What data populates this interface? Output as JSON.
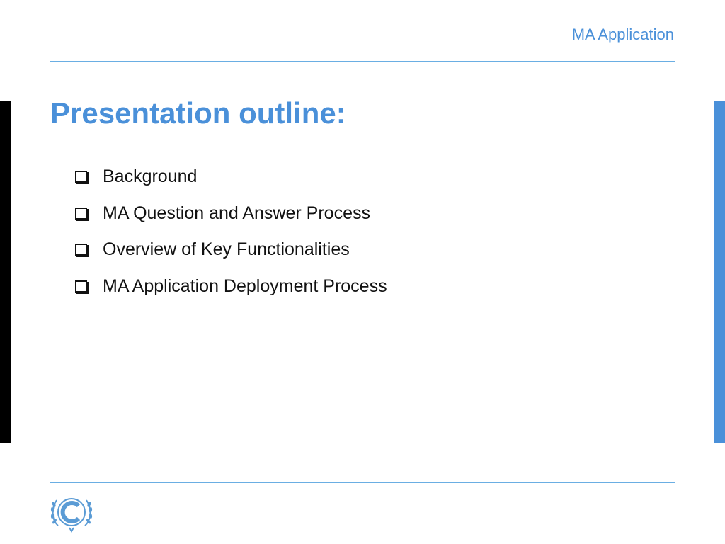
{
  "header": {
    "title": "MA Application"
  },
  "slide": {
    "title": "Presentation outline:",
    "items": [
      {
        "label": "Background"
      },
      {
        "label": "MA Question and Answer Process"
      },
      {
        "label": "Overview of Key Functionalities"
      },
      {
        "label": "MA Application Deployment Process"
      }
    ]
  },
  "footer": {
    "logo_icon": "unfccc-emblem-icon"
  },
  "colors": {
    "accent": "#4a90d9",
    "rule": "#6aaee3",
    "left_bar": "#000000",
    "text": "#111111"
  }
}
